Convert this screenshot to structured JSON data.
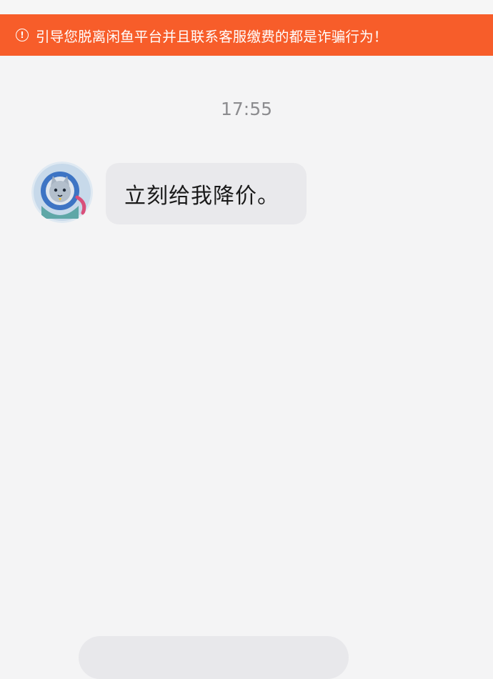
{
  "warning_banner": {
    "icon": "alert-circle-icon",
    "text": "引导您脱离闲鱼平台并且联系客服缴费的都是诈骗行为！",
    "color": "#f75d2a"
  },
  "chat": {
    "timestamp": "17:55",
    "messages": [
      {
        "sender_avatar": "cat-astronaut-avatar",
        "text": "立刻给我降价。"
      }
    ]
  }
}
